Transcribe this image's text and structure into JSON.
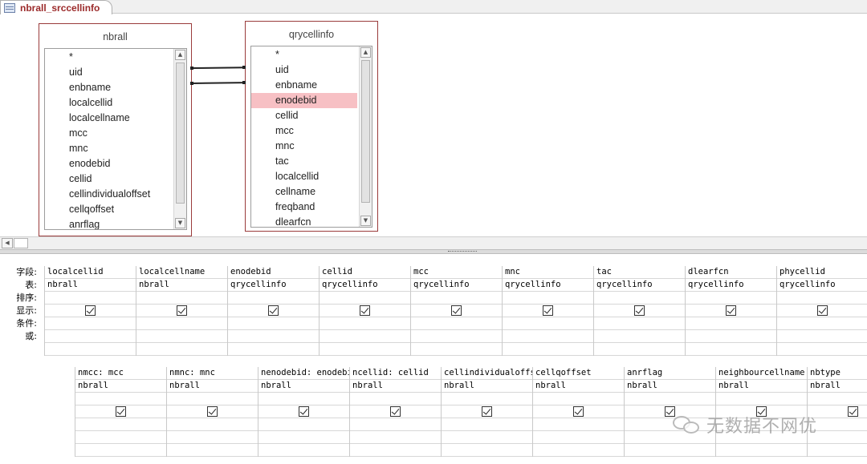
{
  "tab": {
    "title": "nbrall_srccellinfo",
    "icon": "query-icon"
  },
  "tables": {
    "nbrall": {
      "title": "nbrall",
      "fields": [
        "*",
        "uid",
        "enbname",
        "localcellid",
        "localcellname",
        "mcc",
        "mnc",
        "enodebid",
        "cellid",
        "cellindividualoffset",
        "cellqoffset",
        "anrflag"
      ]
    },
    "qrycellinfo": {
      "title": "qrycellinfo",
      "fields": [
        "*",
        "uid",
        "enbname",
        "enodebid",
        "cellid",
        "mcc",
        "mnc",
        "tac",
        "localcellid",
        "cellname",
        "freqband",
        "dlearfcn"
      ],
      "selected": "enodebid"
    }
  },
  "grid": {
    "row_labels": [
      "字段:",
      "表:",
      "排序:",
      "显示:",
      "条件:",
      "或:"
    ],
    "columns": [
      {
        "field": "localcellid",
        "table": "nbrall",
        "show": true
      },
      {
        "field": "localcellname",
        "table": "nbrall",
        "show": true
      },
      {
        "field": "enodebid",
        "table": "qrycellinfo",
        "show": true
      },
      {
        "field": "cellid",
        "table": "qrycellinfo",
        "show": true
      },
      {
        "field": "mcc",
        "table": "qrycellinfo",
        "show": true
      },
      {
        "field": "mnc",
        "table": "qrycellinfo",
        "show": true
      },
      {
        "field": "tac",
        "table": "qrycellinfo",
        "show": true
      },
      {
        "field": "dlearfcn",
        "table": "qrycellinfo",
        "show": true
      },
      {
        "field": "phycellid",
        "table": "qrycellinfo",
        "show": true
      }
    ]
  },
  "grid2": {
    "columns": [
      {
        "field": "nmcc: mcc",
        "table": "nbrall",
        "show": true
      },
      {
        "field": "nmnc: mnc",
        "table": "nbrall",
        "show": true
      },
      {
        "field": "nenodebid: enodebid",
        "table": "nbrall",
        "show": true
      },
      {
        "field": "ncellid: cellid",
        "table": "nbrall",
        "show": true
      },
      {
        "field": "cellindividualoffset",
        "table": "nbrall",
        "show": true
      },
      {
        "field": "cellqoffset",
        "table": "nbrall",
        "show": true
      },
      {
        "field": "anrflag",
        "table": "nbrall",
        "show": true
      },
      {
        "field": "neighbourcellname",
        "table": "nbrall",
        "show": true
      },
      {
        "field": "nbtype",
        "table": "nbrall",
        "show": true
      }
    ]
  },
  "watermark": {
    "text": "无数据不网优",
    "icon": "wechat-icon"
  }
}
